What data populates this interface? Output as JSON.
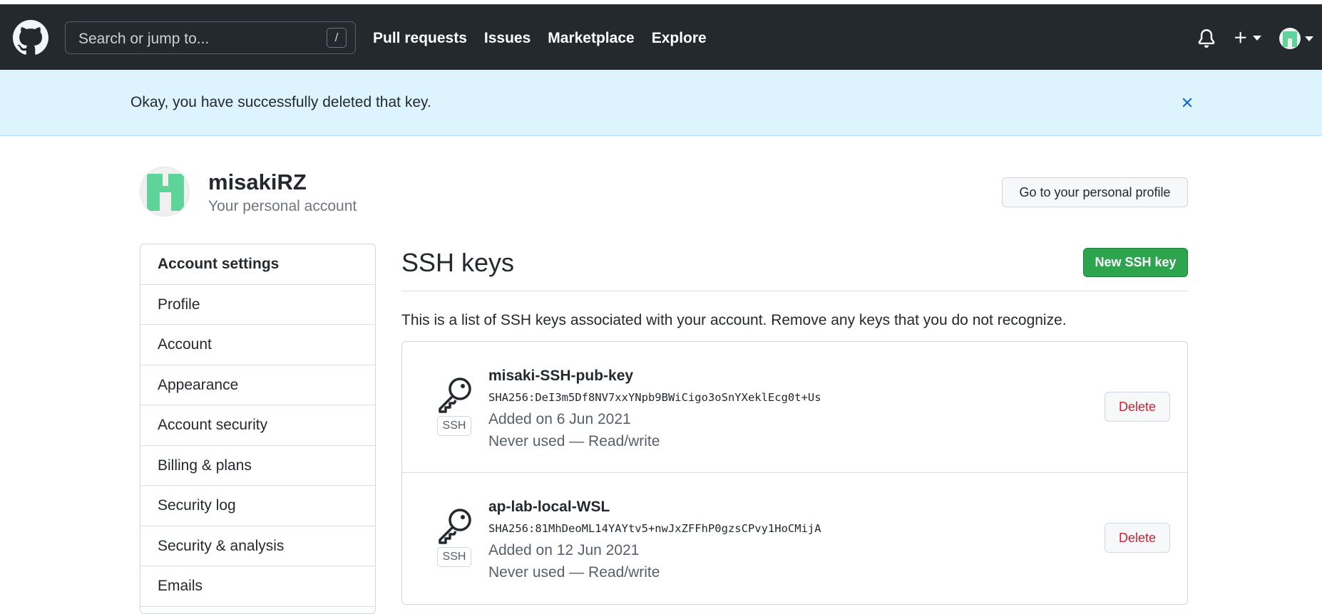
{
  "header": {
    "search_placeholder": "Search or jump to...",
    "search_shortcut": "/",
    "nav": [
      "Pull requests",
      "Issues",
      "Marketplace",
      "Explore"
    ]
  },
  "flash": {
    "message": "Okay, you have successfully deleted that key."
  },
  "profile": {
    "username": "misakiRZ",
    "subtitle": "Your personal account",
    "profile_button": "Go to your personal profile"
  },
  "sidebar": {
    "items": [
      "Account settings",
      "Profile",
      "Account",
      "Appearance",
      "Account security",
      "Billing & plans",
      "Security log",
      "Security & analysis",
      "Emails"
    ]
  },
  "main": {
    "title": "SSH keys",
    "new_button": "New SSH key",
    "description": "This is a list of SSH keys associated with your account. Remove any keys that you do not recognize.",
    "keys": [
      {
        "badge": "SSH",
        "name": "misaki-SSH-pub-key",
        "fingerprint": "SHA256:DeI3m5Df8NV7xxYNpb9BWiCigo3oSnYXeklEcg0t+Us",
        "added": "Added on 6 Jun 2021",
        "usage": "Never used — Read/write",
        "delete_label": "Delete"
      },
      {
        "badge": "SSH",
        "name": "ap-lab-local-WSL",
        "fingerprint": "SHA256:81MhDeoML14YAYtv5+nwJxZFFhP0gzsCPvy1HoCMijA",
        "added": "Added on 12 Jun 2021",
        "usage": "Never used — Read/write",
        "delete_label": "Delete"
      }
    ]
  },
  "colors": {
    "header_bg": "#24292e",
    "flash_bg": "#ddf4ff",
    "primary_green": "#2da44e",
    "danger_red": "#cf222e",
    "avatar_green": "#5ed39a"
  },
  "icons": [
    "github-logo-icon",
    "bell-icon",
    "plus-icon",
    "chevron-down-icon",
    "close-icon",
    "key-icon"
  ]
}
